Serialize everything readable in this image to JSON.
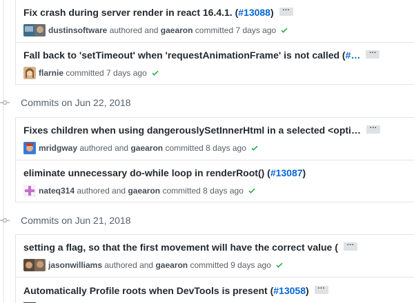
{
  "commits_top": [
    {
      "message": "Fix crash during server render in react 16.4.1. (",
      "pr": "#13088",
      "message_tail": ")",
      "author": "dustinsoftware",
      "verb1": "authored and",
      "committer": "gaearon",
      "verb2": "committed 7 days ago",
      "ellipsis": "…"
    },
    {
      "message": "Fall back to 'setTimeout' when 'requestAnimationFrame' is not called (",
      "pr": "#…",
      "message_tail": "",
      "author": "flarnie",
      "verb1": "",
      "committer": "",
      "verb2": "committed 7 days ago",
      "ellipsis": "…"
    }
  ],
  "groups": [
    {
      "heading": "Commits on Jun 22, 2018",
      "commits": [
        {
          "message": "Fixes children when using dangerouslySetInnerHtml in a selected <opti…",
          "pr": "",
          "message_tail": "",
          "author": "mridgway",
          "verb1": "authored and",
          "committer": "gaearon",
          "verb2": "committed 8 days ago",
          "ellipsis": "…"
        },
        {
          "message": "eliminate unnecessary do-while loop in renderRoot() (",
          "pr": "#13087",
          "message_tail": ")",
          "author": "nateq314",
          "verb1": "authored and",
          "committer": "gaearon",
          "verb2": "committed 8 days ago",
          "ellipsis": ""
        }
      ]
    },
    {
      "heading": "Commits on Jun 21, 2018",
      "commits": [
        {
          "message": "setting a flag, so that the first movement will have the correct value (",
          "pr": "",
          "message_tail": "",
          "author": "jasonwilliams",
          "verb1": "authored and",
          "committer": "gaearon",
          "verb2": "committed 9 days ago",
          "ellipsis": "…"
        },
        {
          "message": "Automatically Profile roots when DevTools is present (",
          "pr": "#13058",
          "message_tail": ")",
          "ellipsis": "…"
        }
      ]
    }
  ],
  "colors": {
    "link": "#0366d6",
    "success": "#28a745",
    "muted": "#586069",
    "border": "#e1e4e8"
  },
  "icons": [
    "commit-icon",
    "check-icon",
    "avatar",
    "ellipsis-button"
  ]
}
